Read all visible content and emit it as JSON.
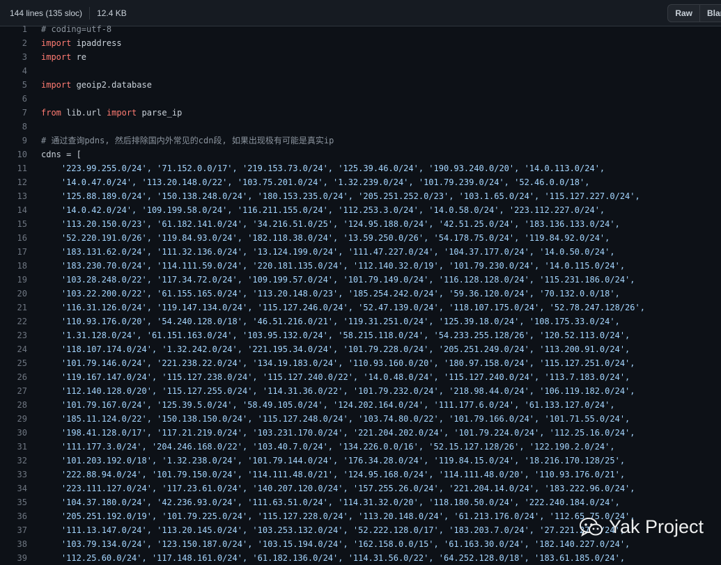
{
  "header": {
    "lines_info": "144 lines (135 sloc)",
    "size": "12.4 KB",
    "raw_label": "Raw",
    "blame_label": "Blame"
  },
  "code": {
    "lines": [
      {
        "n": "1",
        "parts": [
          {
            "t": "# coding=utf-8",
            "c": "c"
          }
        ]
      },
      {
        "n": "2",
        "parts": [
          {
            "t": "import",
            "c": "k"
          },
          {
            "t": " ipaddress"
          }
        ]
      },
      {
        "n": "3",
        "parts": [
          {
            "t": "import",
            "c": "k"
          },
          {
            "t": " re"
          }
        ]
      },
      {
        "n": "4",
        "parts": []
      },
      {
        "n": "5",
        "parts": [
          {
            "t": "import",
            "c": "k"
          },
          {
            "t": " geoip2.database"
          }
        ]
      },
      {
        "n": "6",
        "parts": []
      },
      {
        "n": "7",
        "parts": [
          {
            "t": "from",
            "c": "k"
          },
          {
            "t": " lib.url "
          },
          {
            "t": "import",
            "c": "k"
          },
          {
            "t": " parse_ip"
          }
        ]
      },
      {
        "n": "8",
        "parts": []
      },
      {
        "n": "9",
        "parts": [
          {
            "t": "# 通过查询pdns, 然后排除国内外常见的cdn段, 如果出现极有可能是真实ip",
            "c": "c"
          }
        ]
      },
      {
        "n": "10",
        "parts": [
          {
            "t": "cdns = ["
          }
        ]
      },
      {
        "n": "11",
        "parts": [
          {
            "t": "    '223.99.255.0/24', '71.152.0.0/17', '219.153.73.0/24', '125.39.46.0/24', '190.93.240.0/20', '14.0.113.0/24',",
            "c": "s"
          }
        ]
      },
      {
        "n": "12",
        "parts": [
          {
            "t": "    '14.0.47.0/24', '113.20.148.0/22', '103.75.201.0/24', '1.32.239.0/24', '101.79.239.0/24', '52.46.0.0/18',",
            "c": "s"
          }
        ]
      },
      {
        "n": "13",
        "parts": [
          {
            "t": "    '125.88.189.0/24', '150.138.248.0/24', '180.153.235.0/24', '205.251.252.0/23', '103.1.65.0/24', '115.127.227.0/24',",
            "c": "s"
          }
        ]
      },
      {
        "n": "14",
        "parts": [
          {
            "t": "    '14.0.42.0/24', '109.199.58.0/24', '116.211.155.0/24', '112.253.3.0/24', '14.0.58.0/24', '223.112.227.0/24',",
            "c": "s"
          }
        ]
      },
      {
        "n": "15",
        "parts": [
          {
            "t": "    '113.20.150.0/23', '61.182.141.0/24', '34.216.51.0/25', '124.95.188.0/24', '42.51.25.0/24', '183.136.133.0/24',",
            "c": "s"
          }
        ]
      },
      {
        "n": "16",
        "parts": [
          {
            "t": "    '52.220.191.0/26', '119.84.93.0/24', '182.118.38.0/24', '13.59.250.0/26', '54.178.75.0/24', '119.84.92.0/24',",
            "c": "s"
          }
        ]
      },
      {
        "n": "17",
        "parts": [
          {
            "t": "    '183.131.62.0/24', '111.32.136.0/24', '13.124.199.0/24', '111.47.227.0/24', '104.37.177.0/24', '14.0.50.0/24',",
            "c": "s"
          }
        ]
      },
      {
        "n": "18",
        "parts": [
          {
            "t": "    '183.230.70.0/24', '114.111.59.0/24', '220.181.135.0/24', '112.140.32.0/19', '101.79.230.0/24', '14.0.115.0/24',",
            "c": "s"
          }
        ]
      },
      {
        "n": "19",
        "parts": [
          {
            "t": "    '103.28.248.0/22', '117.34.72.0/24', '109.199.57.0/24', '101.79.149.0/24', '116.128.128.0/24', '115.231.186.0/24',",
            "c": "s"
          }
        ]
      },
      {
        "n": "20",
        "parts": [
          {
            "t": "    '103.22.200.0/22', '61.155.165.0/24', '113.20.148.0/23', '185.254.242.0/24', '59.36.120.0/24', '70.132.0.0/18',",
            "c": "s"
          }
        ]
      },
      {
        "n": "21",
        "parts": [
          {
            "t": "    '116.31.126.0/24', '119.147.134.0/24', '115.127.246.0/24', '52.47.139.0/24', '118.107.175.0/24', '52.78.247.128/26',",
            "c": "s"
          }
        ]
      },
      {
        "n": "22",
        "parts": [
          {
            "t": "    '110.93.176.0/20', '54.240.128.0/18', '46.51.216.0/21', '119.31.251.0/24', '125.39.18.0/24', '108.175.33.0/24',",
            "c": "s"
          }
        ]
      },
      {
        "n": "23",
        "parts": [
          {
            "t": "    '1.31.128.0/24', '61.151.163.0/24', '103.95.132.0/24', '58.215.118.0/24', '54.233.255.128/26', '120.52.113.0/24',",
            "c": "s"
          }
        ]
      },
      {
        "n": "24",
        "parts": [
          {
            "t": "    '118.107.174.0/24', '1.32.242.0/24', '221.195.34.0/24', '101.79.228.0/24', '205.251.249.0/24', '113.200.91.0/24',",
            "c": "s"
          }
        ]
      },
      {
        "n": "25",
        "parts": [
          {
            "t": "    '101.79.146.0/24', '221.238.22.0/24', '134.19.183.0/24', '110.93.160.0/20', '180.97.158.0/24', '115.127.251.0/24',",
            "c": "s"
          }
        ]
      },
      {
        "n": "26",
        "parts": [
          {
            "t": "    '119.167.147.0/24', '115.127.238.0/24', '115.127.240.0/22', '14.0.48.0/24', '115.127.240.0/24', '113.7.183.0/24',",
            "c": "s"
          }
        ]
      },
      {
        "n": "27",
        "parts": [
          {
            "t": "    '112.140.128.0/20', '115.127.255.0/24', '114.31.36.0/22', '101.79.232.0/24', '218.98.44.0/24', '106.119.182.0/24',",
            "c": "s"
          }
        ]
      },
      {
        "n": "28",
        "parts": [
          {
            "t": "    '101.79.167.0/24', '125.39.5.0/24', '58.49.105.0/24', '124.202.164.0/24', '111.177.6.0/24', '61.133.127.0/24',",
            "c": "s"
          }
        ]
      },
      {
        "n": "29",
        "parts": [
          {
            "t": "    '185.11.124.0/22', '150.138.150.0/24', '115.127.248.0/24', '103.74.80.0/22', '101.79.166.0/24', '101.71.55.0/24',",
            "c": "s"
          }
        ]
      },
      {
        "n": "30",
        "parts": [
          {
            "t": "    '198.41.128.0/17', '117.21.219.0/24', '103.231.170.0/24', '221.204.202.0/24', '101.79.224.0/24', '112.25.16.0/24',",
            "c": "s"
          }
        ]
      },
      {
        "n": "31",
        "parts": [
          {
            "t": "    '111.177.3.0/24', '204.246.168.0/22', '103.40.7.0/24', '134.226.0.0/16', '52.15.127.128/26', '122.190.2.0/24',",
            "c": "s"
          }
        ]
      },
      {
        "n": "32",
        "parts": [
          {
            "t": "    '101.203.192.0/18', '1.32.238.0/24', '101.79.144.0/24', '176.34.28.0/24', '119.84.15.0/24', '18.216.170.128/25',",
            "c": "s"
          }
        ]
      },
      {
        "n": "33",
        "parts": [
          {
            "t": "    '222.88.94.0/24', '101.79.150.0/24', '114.111.48.0/21', '124.95.168.0/24', '114.111.48.0/20', '110.93.176.0/21',",
            "c": "s"
          }
        ]
      },
      {
        "n": "34",
        "parts": [
          {
            "t": "    '223.111.127.0/24', '117.23.61.0/24', '140.207.120.0/24', '157.255.26.0/24', '221.204.14.0/24', '183.222.96.0/24',",
            "c": "s"
          }
        ]
      },
      {
        "n": "35",
        "parts": [
          {
            "t": "    '104.37.180.0/24', '42.236.93.0/24', '111.63.51.0/24', '114.31.32.0/20', '118.180.50.0/24', '222.240.184.0/24',",
            "c": "s"
          }
        ]
      },
      {
        "n": "36",
        "parts": [
          {
            "t": "    '205.251.192.0/19', '101.79.225.0/24', '115.127.228.0/24', '113.20.148.0/24', '61.213.176.0/24', '112.65.75.0/24',",
            "c": "s"
          }
        ]
      },
      {
        "n": "37",
        "parts": [
          {
            "t": "    '111.13.147.0/24', '113.20.145.0/24', '103.253.132.0/24', '52.222.128.0/17', '183.203.7.0/24', '27.221.27.0/24',",
            "c": "s"
          }
        ]
      },
      {
        "n": "38",
        "parts": [
          {
            "t": "    '103.79.134.0/24', '123.150.187.0/24', '103.15.194.0/24', '162.158.0.0/15', '61.163.30.0/24', '182.140.227.0/24',",
            "c": "s"
          }
        ]
      },
      {
        "n": "39",
        "parts": [
          {
            "t": "    '112.25.60.0/24', '117.148.161.0/24', '61.182.136.0/24', '114.31.56.0/22', '64.252.128.0/18', '183.61.185.0/24',",
            "c": "s"
          }
        ]
      }
    ]
  },
  "watermark": {
    "text": "Yak Project",
    "icon": "wechat-icon"
  },
  "colors": {
    "background": "#0d1117",
    "comment": "#8b949e",
    "keyword": "#ff7b72",
    "string": "#a5d6ff",
    "line_number": "#6e7681"
  }
}
